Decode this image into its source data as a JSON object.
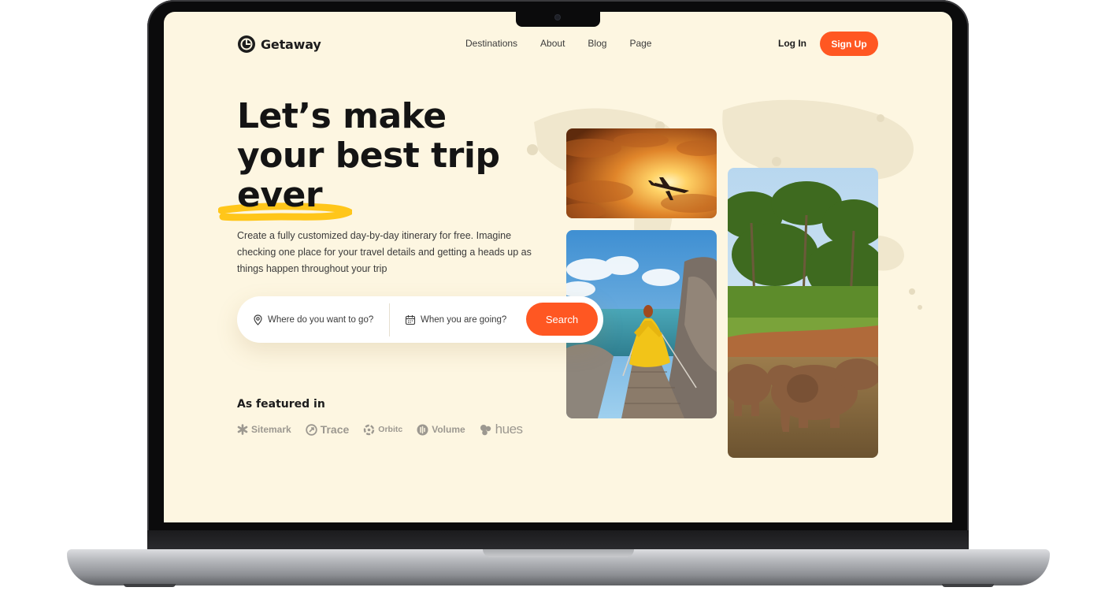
{
  "brand": {
    "name": "Getaway",
    "accent": "#ff5722",
    "background": "#fdf6e1"
  },
  "nav": {
    "links": [
      "Destinations",
      "About",
      "Blog",
      "Page"
    ],
    "login": "Log In",
    "signup": "Sign Up"
  },
  "hero": {
    "title_line1": "Let’s make",
    "title_line2": "your best trip",
    "title_line3": "ever",
    "description": "Create a fully customized day-by-day itinerary for free. Imagine checking one place for your travel details and getting a heads up as things happen throughout your trip"
  },
  "search": {
    "where_placeholder": "Where do you want to go?",
    "when_placeholder": "When you are going?",
    "button": "Search"
  },
  "featured": {
    "title": "As featured in",
    "brands": [
      "Sitemark",
      "Trace",
      "Orbitc",
      "Volume",
      "hues"
    ]
  },
  "photos": [
    {
      "subject": "airplane-sunset"
    },
    {
      "subject": "woman-yellow-dress-boardwalk"
    },
    {
      "subject": "elephants-river-palms"
    }
  ]
}
